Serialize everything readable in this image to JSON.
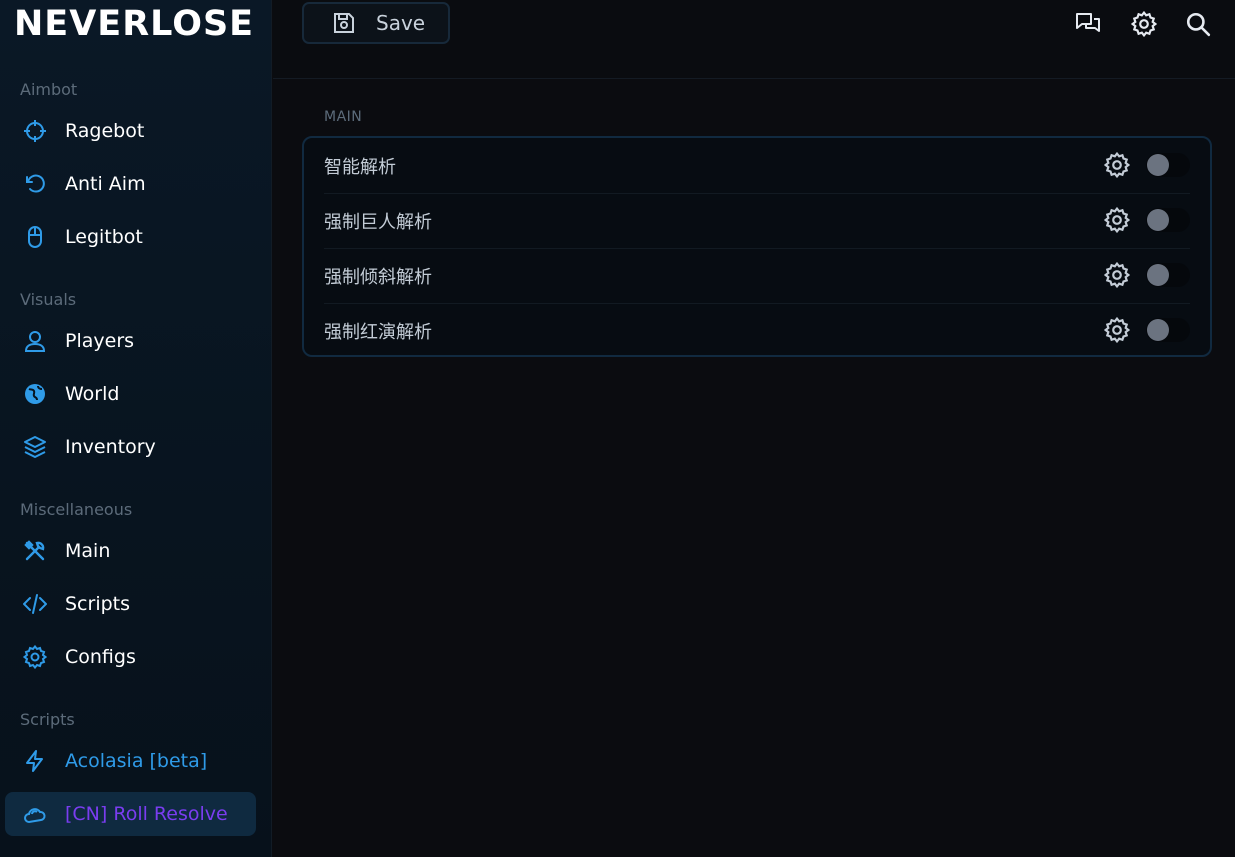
{
  "app": {
    "logo": "NEVERLOSE"
  },
  "sidebar": {
    "sections": [
      {
        "title": "Aimbot"
      },
      {
        "title": "Visuals"
      },
      {
        "title": "Miscellaneous"
      },
      {
        "title": "Scripts"
      }
    ],
    "items": [
      {
        "label": "Ragebot",
        "icon": "crosshair-icon"
      },
      {
        "label": "Anti Aim",
        "icon": "rotate-icon"
      },
      {
        "label": "Legitbot",
        "icon": "mouse-icon"
      },
      {
        "label": "Players",
        "icon": "user-icon"
      },
      {
        "label": "World",
        "icon": "globe-icon"
      },
      {
        "label": "Inventory",
        "icon": "layers-icon"
      },
      {
        "label": "Main",
        "icon": "tools-icon"
      },
      {
        "label": "Scripts",
        "icon": "code-icon"
      },
      {
        "label": "Configs",
        "icon": "gear-icon"
      },
      {
        "label": "Acolasia [beta]",
        "icon": "bolt-icon"
      },
      {
        "label": "[CN] Roll Resolve",
        "icon": "cloud-icon",
        "active": true
      }
    ]
  },
  "toolbar": {
    "save_label": "Save"
  },
  "main": {
    "group_title": "MAIN",
    "rows": [
      {
        "label": "智能解析",
        "enabled": false
      },
      {
        "label": "强制巨人解析",
        "enabled": false
      },
      {
        "label": "强制倾斜解析",
        "enabled": false
      },
      {
        "label": "强制红演解析",
        "enabled": false
      }
    ]
  },
  "colors": {
    "accent": "#2f9be8",
    "active_text": "#7a3df0",
    "background": "#0b0c10"
  }
}
